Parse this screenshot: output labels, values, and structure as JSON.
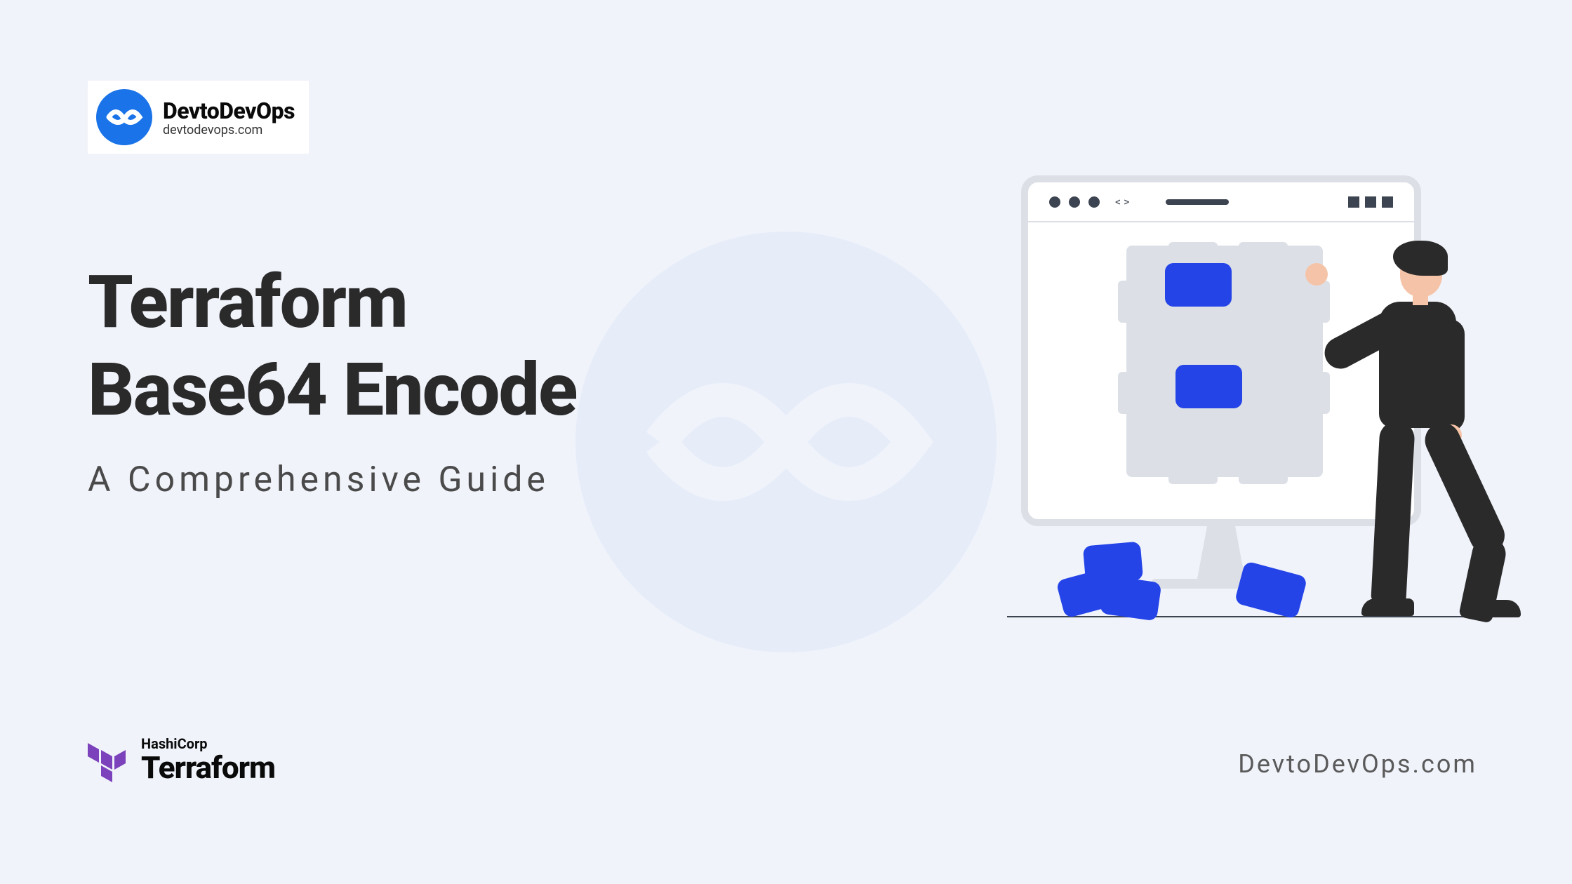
{
  "header": {
    "logo_title": "DevtoDevOps",
    "logo_subtitle": "devtodevops.com"
  },
  "main": {
    "title_line1": "Terraform",
    "title_line2": "Base64 Encode",
    "subtitle": "A Comprehensive Guide"
  },
  "footer": {
    "terraform_company": "HashiCorp",
    "terraform_product": "Terraform",
    "brand": "DevtoDevOps.com"
  },
  "browser": {
    "code_symbol": "< >"
  }
}
